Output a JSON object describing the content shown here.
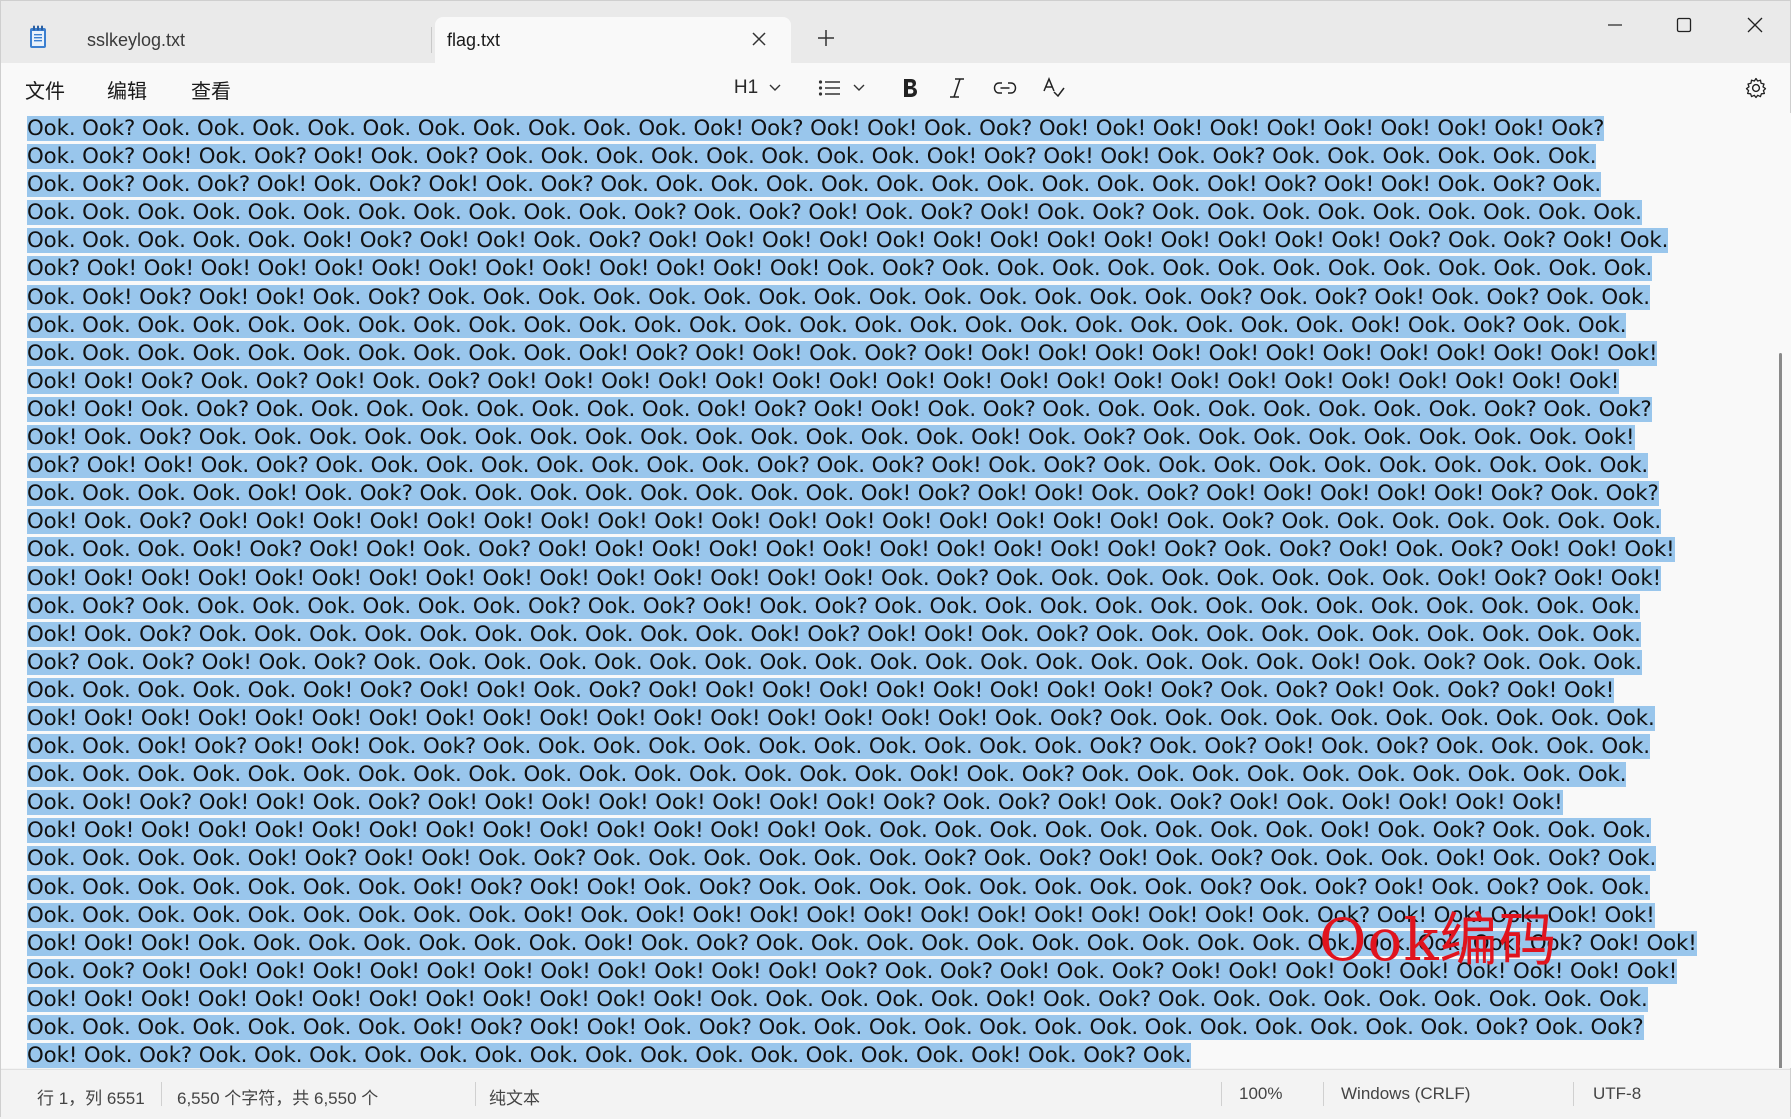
{
  "tabs": [
    {
      "label": "sslkeylog.txt"
    },
    {
      "label": "flag.txt"
    }
  ],
  "menu": {
    "file": "文件",
    "edit": "编辑",
    "view": "查看"
  },
  "toolbar": {
    "heading": "H1"
  },
  "editor": {
    "lines": [
      "Ook. Ook? Ook. Ook. Ook. Ook. Ook. Ook. Ook. Ook. Ook. Ook. Ook! Ook? Ook! Ook! Ook. Ook? Ook! Ook! Ook! Ook! Ook! Ook! Ook! Ook! Ook! Ook?",
      "Ook. Ook? Ook! Ook. Ook? Ook! Ook. Ook? Ook. Ook. Ook. Ook. Ook. Ook. Ook. Ook. Ook! Ook? Ook! Ook! Ook. Ook? Ook. Ook. Ook. Ook. Ook. Ook.",
      "Ook. Ook? Ook. Ook? Ook! Ook. Ook? Ook! Ook. Ook? Ook. Ook. Ook. Ook. Ook. Ook. Ook. Ook. Ook. Ook. Ook. Ook! Ook? Ook! Ook! Ook. Ook? Ook.",
      "Ook. Ook. Ook. Ook. Ook. Ook. Ook. Ook. Ook. Ook. Ook. Ook? Ook. Ook? Ook! Ook. Ook? Ook! Ook. Ook? Ook. Ook. Ook. Ook. Ook. Ook. Ook. Ook. Ook.",
      "Ook. Ook. Ook. Ook. Ook. Ook! Ook? Ook! Ook! Ook. Ook? Ook! Ook! Ook! Ook! Ook! Ook! Ook! Ook! Ook! Ook! Ook! Ook! Ook! Ook? Ook. Ook? Ook! Ook.",
      "Ook? Ook! Ook! Ook! Ook! Ook! Ook! Ook! Ook! Ook! Ook! Ook! Ook! Ook! Ook. Ook? Ook. Ook. Ook. Ook. Ook. Ook. Ook. Ook. Ook. Ook. Ook. Ook. Ook.",
      "Ook. Ook! Ook? Ook! Ook! Ook. Ook? Ook. Ook. Ook. Ook. Ook. Ook. Ook. Ook. Ook. Ook. Ook. Ook. Ook. Ook. Ook? Ook. Ook? Ook! Ook. Ook? Ook. Ook.",
      "Ook. Ook. Ook. Ook. Ook. Ook. Ook. Ook. Ook. Ook. Ook. Ook. Ook. Ook. Ook. Ook. Ook. Ook. Ook. Ook. Ook. Ook. Ook. Ook. Ook! Ook. Ook? Ook. Ook.",
      "Ook. Ook. Ook. Ook. Ook. Ook. Ook. Ook. Ook. Ook. Ook! Ook? Ook! Ook! Ook. Ook? Ook! Ook! Ook! Ook! Ook! Ook! Ook! Ook! Ook! Ook! Ook! Ook! Ook!",
      "Ook! Ook! Ook? Ook. Ook? Ook! Ook. Ook? Ook! Ook! Ook! Ook! Ook! Ook! Ook! Ook! Ook! Ook! Ook! Ook! Ook! Ook! Ook! Ook! Ook! Ook! Ook! Ook!",
      "Ook! Ook! Ook. Ook? Ook. Ook. Ook. Ook. Ook. Ook. Ook. Ook. Ook! Ook? Ook! Ook! Ook. Ook? Ook. Ook. Ook. Ook. Ook. Ook. Ook. Ook. Ook? Ook. Ook?",
      "Ook! Ook. Ook? Ook. Ook. Ook. Ook. Ook. Ook. Ook. Ook. Ook. Ook. Ook. Ook. Ook. Ook. Ook! Ook. Ook? Ook. Ook. Ook. Ook. Ook. Ook. Ook. Ook. Ook!",
      "Ook? Ook! Ook! Ook. Ook? Ook. Ook. Ook. Ook. Ook. Ook. Ook. Ook. Ook? Ook. Ook? Ook! Ook. Ook? Ook. Ook. Ook. Ook. Ook. Ook. Ook. Ook. Ook. Ook.",
      "Ook. Ook. Ook. Ook. Ook! Ook. Ook? Ook. Ook. Ook. Ook. Ook. Ook. Ook. Ook. Ook! Ook? Ook! Ook! Ook. Ook? Ook! Ook! Ook! Ook! Ook! Ook? Ook. Ook?",
      "Ook! Ook. Ook? Ook! Ook! Ook! Ook! Ook! Ook! Ook! Ook! Ook! Ook! Ook! Ook! Ook! Ook! Ook! Ook! Ook! Ook. Ook? Ook. Ook. Ook. Ook. Ook. Ook. Ook.",
      "Ook. Ook. Ook. Ook! Ook? Ook! Ook! Ook. Ook? Ook! Ook! Ook! Ook! Ook! Ook! Ook! Ook! Ook! Ook! Ook! Ook? Ook. Ook? Ook! Ook. Ook? Ook! Ook! Ook!",
      "Ook! Ook! Ook! Ook! Ook! Ook! Ook! Ook! Ook! Ook! Ook! Ook! Ook! Ook! Ook! Ook. Ook? Ook. Ook. Ook. Ook. Ook. Ook. Ook. Ook. Ook! Ook? Ook! Ook!",
      "Ook. Ook? Ook. Ook. Ook. Ook. Ook. Ook. Ook. Ook? Ook. Ook? Ook! Ook. Ook? Ook. Ook. Ook. Ook. Ook. Ook. Ook. Ook. Ook. Ook. Ook. Ook. Ook. Ook.",
      "Ook! Ook. Ook? Ook. Ook. Ook. Ook. Ook. Ook. Ook. Ook. Ook. Ook. Ook! Ook? Ook! Ook! Ook. Ook? Ook. Ook. Ook. Ook. Ook. Ook. Ook. Ook. Ook. Ook.",
      "Ook? Ook. Ook? Ook! Ook. Ook? Ook. Ook. Ook. Ook. Ook. Ook. Ook. Ook. Ook. Ook. Ook. Ook. Ook. Ook. Ook. Ook. Ook. Ook! Ook. Ook? Ook. Ook. Ook.",
      "Ook. Ook. Ook. Ook. Ook. Ook! Ook? Ook! Ook! Ook. Ook? Ook! Ook! Ook! Ook! Ook! Ook! Ook! Ook! Ook! Ook? Ook. Ook? Ook! Ook. Ook? Ook! Ook!",
      "Ook! Ook! Ook! Ook! Ook! Ook! Ook! Ook! Ook! Ook! Ook! Ook! Ook! Ook! Ook! Ook! Ook! Ook. Ook? Ook. Ook. Ook. Ook. Ook. Ook. Ook. Ook. Ook. Ook.",
      "Ook. Ook. Ook! Ook? Ook! Ook! Ook. Ook? Ook. Ook. Ook. Ook. Ook. Ook. Ook. Ook. Ook. Ook. Ook. Ook? Ook. Ook? Ook! Ook. Ook? Ook. Ook. Ook. Ook.",
      "Ook. Ook. Ook. Ook. Ook. Ook. Ook. Ook. Ook. Ook. Ook. Ook. Ook. Ook. Ook. Ook. Ook! Ook. Ook? Ook. Ook. Ook. Ook. Ook. Ook. Ook. Ook. Ook. Ook.",
      "Ook. Ook! Ook? Ook! Ook! Ook. Ook? Ook! Ook! Ook! Ook! Ook! Ook! Ook! Ook! Ook? Ook. Ook? Ook! Ook. Ook? Ook! Ook. Ook! Ook! Ook! Ook!",
      "Ook! Ook! Ook! Ook! Ook! Ook! Ook! Ook! Ook! Ook! Ook! Ook! Ook! Ook! Ook. Ook. Ook. Ook. Ook. Ook. Ook. Ook. Ook. Ook! Ook. Ook? Ook. Ook. Ook.",
      "Ook. Ook. Ook. Ook. Ook! Ook? Ook! Ook! Ook. Ook? Ook. Ook. Ook. Ook. Ook. Ook. Ook? Ook. Ook? Ook! Ook. Ook? Ook. Ook. Ook. Ook! Ook. Ook? Ook.",
      "Ook. Ook. Ook. Ook. Ook. Ook. Ook. Ook! Ook? Ook! Ook! Ook. Ook? Ook. Ook. Ook. Ook. Ook. Ook. Ook. Ook. Ook? Ook. Ook? Ook! Ook. Ook? Ook. Ook.",
      "Ook. Ook. Ook. Ook. Ook. Ook. Ook. Ook. Ook. Ook! Ook. Ook! Ook! Ook! Ook! Ook! Ook! Ook! Ook! Ook! Ook! Ook! Ook. Ook? Ook! Ook! Ook! Ook! Ook!",
      "Ook! Ook! Ook! Ook. Ook. Ook. Ook. Ook. Ook. Ook. Ook! Ook. Ook? Ook. Ook. Ook. Ook. Ook. Ook. Ook. Ook. Ook. Ook. Ook. Ook. Ook. Ook! Ook? Ook! Ook!",
      "Ook. Ook? Ook! Ook! Ook! Ook! Ook! Ook! Ook! Ook! Ook! Ook! Ook! Ook! Ook? Ook. Ook? Ook! Ook. Ook? Ook! Ook! Ook! Ook! Ook! Ook! Ook! Ook! Ook!",
      "Ook! Ook! Ook! Ook! Ook! Ook! Ook! Ook! Ook! Ook! Ook! Ook! Ook. Ook. Ook. Ook. Ook. Ook! Ook. Ook? Ook. Ook. Ook. Ook. Ook. Ook. Ook. Ook. Ook.",
      "Ook. Ook. Ook. Ook. Ook. Ook. Ook. Ook! Ook? Ook! Ook! Ook. Ook? Ook. Ook. Ook. Ook. Ook. Ook. Ook. Ook. Ook. Ook. Ook. Ook. Ook. Ook? Ook. Ook?",
      "Ook! Ook. Ook? Ook. Ook. Ook. Ook. Ook. Ook. Ook. Ook. Ook. Ook. Ook. Ook. Ook. Ook. Ook! Ook. Ook? Ook."
    ]
  },
  "watermark": "Ook编码",
  "status": {
    "position": "行 1，列 6551",
    "chars": "6,550 个字符，共 6,550 个",
    "format": "纯文本",
    "zoom": "100%",
    "eol": "Windows (CRLF)",
    "encoding": "UTF-8"
  }
}
